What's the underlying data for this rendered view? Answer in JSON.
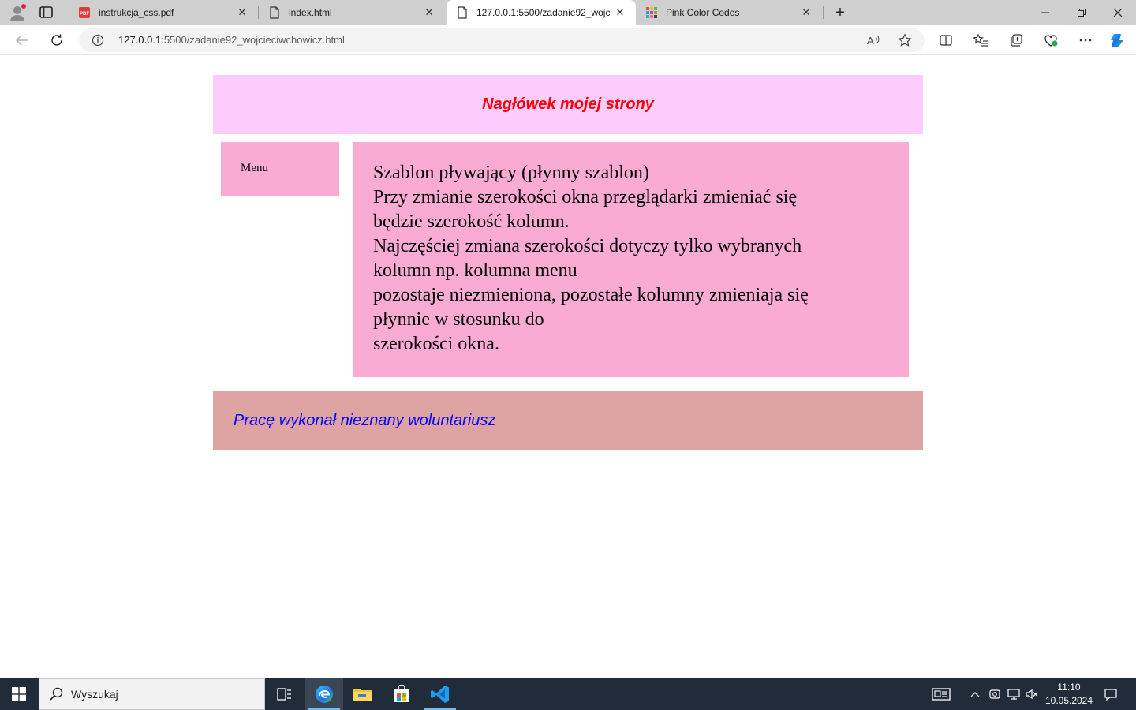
{
  "browser": {
    "tabs": [
      {
        "title": "instrukcja_css.pdf",
        "icon": "pdf-icon",
        "active": false
      },
      {
        "title": "index.html",
        "icon": "file-icon",
        "active": false
      },
      {
        "title": "127.0.0.1:5500/zadanie92_wojcie",
        "icon": "file-icon",
        "active": true
      },
      {
        "title": "Pink Color Codes",
        "icon": "color-grid-icon",
        "active": false
      }
    ],
    "address_host": "127.0.0.1",
    "address_path": ":5500/zadanie92_wojcieciwchowicz.html"
  },
  "page": {
    "header_title": "Nagłówek mojej strony",
    "menu_label": "Menu",
    "content_lines": [
      "Szablon pływający (płynny szablon)",
      "Przy zmianie szerokości okna przeglądarki zmieniać się",
      "będzie szerokość kolumn.",
      "Najczęściej zmiana szerokości dotyczy tylko wybranych",
      "kolumn np. kolumna menu",
      "pozostaje niezmieniona, pozostałe kolumny zmieniaja się",
      "płynnie w stosunku do",
      "szerokości okna."
    ],
    "footer_text": "Pracę wykonał nieznany woluntariusz",
    "colors": {
      "header_bg": "#fecbfe",
      "header_text": "#ff0000",
      "column_bg": "#f9abd4",
      "footer_bg": "#dea3a3",
      "footer_text": "#0000ff"
    }
  },
  "taskbar": {
    "search_placeholder": "Wyszukaj",
    "time": "11:10",
    "date": "10.05.2024"
  }
}
